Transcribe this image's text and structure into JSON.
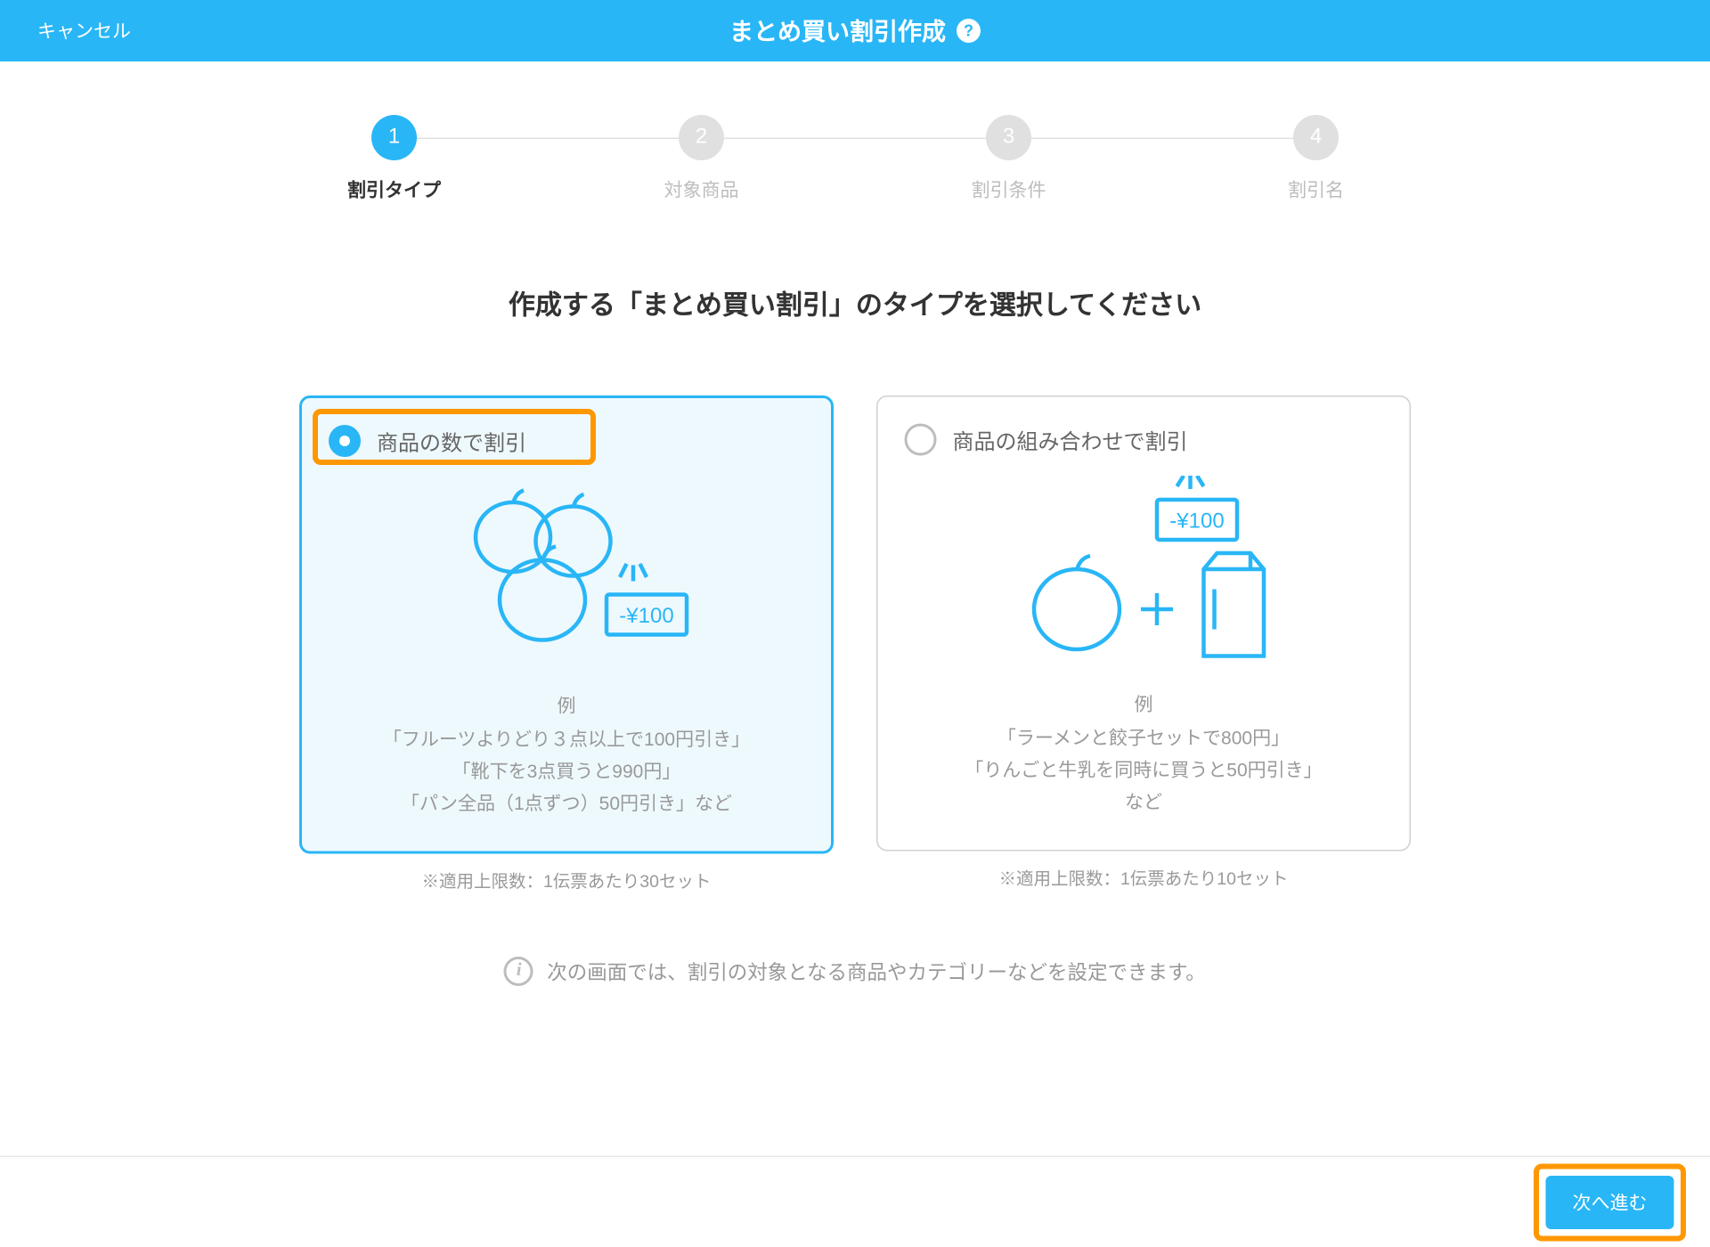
{
  "header": {
    "cancel": "キャンセル",
    "title": "まとめ買い割引作成"
  },
  "steps": [
    {
      "num": "1",
      "label": "割引タイプ"
    },
    {
      "num": "2",
      "label": "対象商品"
    },
    {
      "num": "3",
      "label": "割引条件"
    },
    {
      "num": "4",
      "label": "割引名"
    }
  ],
  "main_title": "作成する「まとめ買い割引」のタイプを選択してください",
  "options": {
    "quantity": {
      "title": "商品の数で割引",
      "example_label": "例",
      "example1": "「フルーツよりどり３点以上で100円引き」",
      "example2": "「靴下を3点買うと990円」",
      "example3": "「パン全品（1点ずつ）50円引き」など",
      "limit": "※適用上限数：1伝票あたり30セット",
      "discount_badge": "-¥100"
    },
    "combination": {
      "title": "商品の組み合わせで割引",
      "example_label": "例",
      "example1": "「ラーメンと餃子セットで800円」",
      "example2": "「りんごと牛乳を同時に買うと50円引き」",
      "example3": "など",
      "limit": "※適用上限数：1伝票あたり10セット",
      "discount_badge": "-¥100"
    }
  },
  "info_text": "次の画面では、割引の対象となる商品やカテゴリーなどを設定できます。",
  "footer": {
    "next": "次へ進む"
  }
}
